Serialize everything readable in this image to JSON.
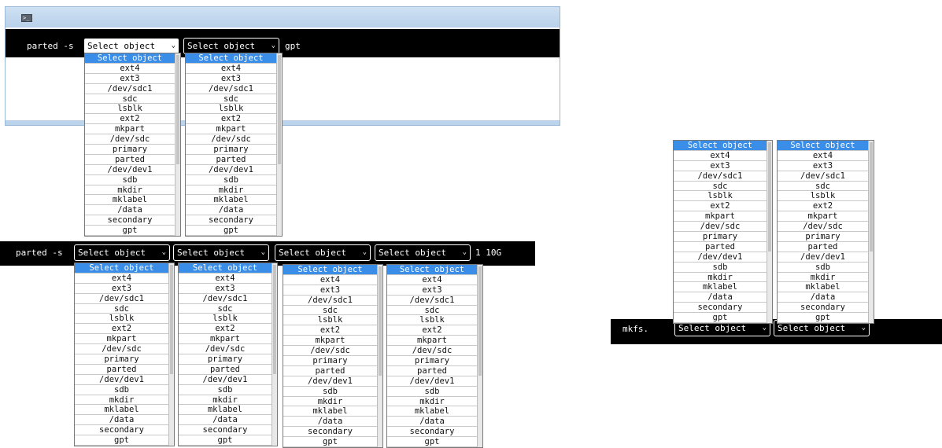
{
  "options": [
    "Select object",
    "ext4",
    "ext3",
    "/dev/sdc1",
    "sdc",
    "lsblk",
    "ext2",
    "mkpart",
    "/dev/sdc",
    "primary",
    "parted",
    "/dev/dev1",
    "sdb",
    "mkdir",
    "mklabel",
    "/data",
    "secondary",
    "gpt"
  ],
  "placeholder": "Select object",
  "chevron": "⌄",
  "term_icon": ">_",
  "panel1": {
    "prefix": "parted -s",
    "suffix": "gpt"
  },
  "panel2": {
    "prefix": "parted -s",
    "suffix": "1 10G"
  },
  "panel3": {
    "prefix": "mkfs."
  },
  "colors": {
    "terminal_bg": "#000000",
    "terminal_fg": "#ffffff",
    "highlight": "#3b8ee8",
    "window_frame": "#bcd3ec"
  }
}
